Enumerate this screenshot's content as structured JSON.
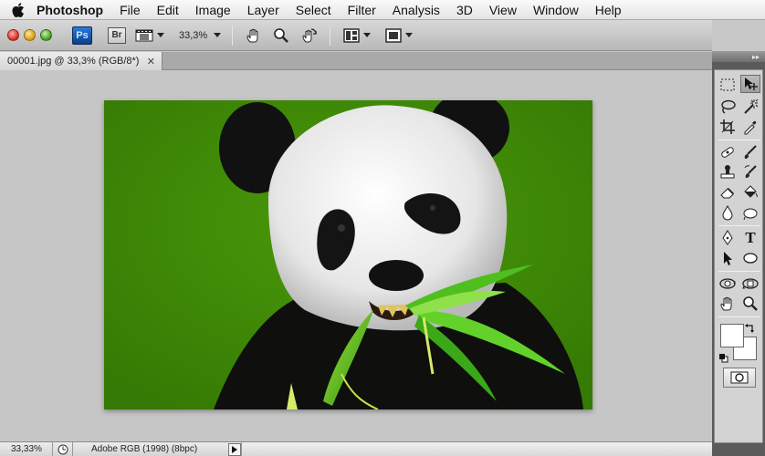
{
  "menubar": {
    "apple_icon": "apple-logo-icon",
    "app_name": "Photoshop",
    "items": [
      "File",
      "Edit",
      "Image",
      "Layer",
      "Select",
      "Filter",
      "Analysis",
      "3D",
      "View",
      "Window",
      "Help"
    ]
  },
  "appbar": {
    "ps_badge": "Ps",
    "br_badge": "Br",
    "zoom": "33,3%"
  },
  "document": {
    "tab_title": "00001.jpg @ 33,3% (RGB/8*)",
    "close_glyph": "✕"
  },
  "status": {
    "zoom": "33,33%",
    "doc_info": "Adobe RGB (1998) (8bpc)"
  },
  "tools_panel": {
    "collapse_glyph": "▸▸",
    "type_tool_glyph": "T"
  },
  "colors": {
    "image_background": "#3d8a05",
    "panel_dark": "#5b5b5b",
    "workspace": "#c6c6c6",
    "ps_blue": "#0b3f8a"
  }
}
